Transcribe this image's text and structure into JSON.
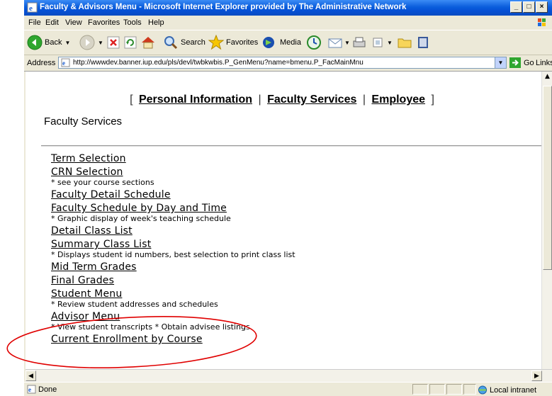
{
  "window": {
    "title": "Faculty & Advisors Menu - Microsoft Internet Explorer provided by The Administrative Network",
    "buttons": [
      "_",
      "□",
      "×"
    ]
  },
  "menubar": {
    "items": [
      "File",
      "Edit",
      "View",
      "Favorites",
      "Tools",
      "Help"
    ]
  },
  "toolbar": {
    "back": "Back",
    "search": "Search",
    "favorites": "Favorites",
    "media": "Media"
  },
  "address": {
    "label": "Address",
    "url": "http://wwwdev.banner.iup.edu/pls/devl/twbkwbis.P_GenMenu?name=bmenu.P_FacMainMnu",
    "go": "Go",
    "links": "Links"
  },
  "nav": {
    "open": "[",
    "close": "]",
    "sep": "|",
    "links": [
      "Personal Information",
      "Faculty Services",
      "Employee"
    ]
  },
  "page_title": "Faculty Services",
  "menu_items": [
    {
      "label": "Term Selection",
      "desc": ""
    },
    {
      "label": "CRN Selection",
      "desc": "* see your course sections"
    },
    {
      "label": "Faculty Detail Schedule",
      "desc": ""
    },
    {
      "label": "Faculty Schedule by Day and Time",
      "desc": "* Graphic display of week's teaching schedule"
    },
    {
      "label": "Detail Class List",
      "desc": ""
    },
    {
      "label": "Summary Class List",
      "desc": "* Displays student id numbers, best selection to print class list"
    },
    {
      "label": "Mid Term Grades",
      "desc": ""
    },
    {
      "label": "Final Grades",
      "desc": ""
    },
    {
      "label": "Student Menu",
      "desc": "* Review student addresses and schedules"
    },
    {
      "label": "Advisor Menu",
      "desc": "* View student transcripts * Obtain advisee listings"
    },
    {
      "label": "Current Enrollment by Course",
      "desc": ""
    }
  ],
  "status": {
    "text": "Done",
    "zone": "Local intranet"
  },
  "annotation_color": "#e00000"
}
